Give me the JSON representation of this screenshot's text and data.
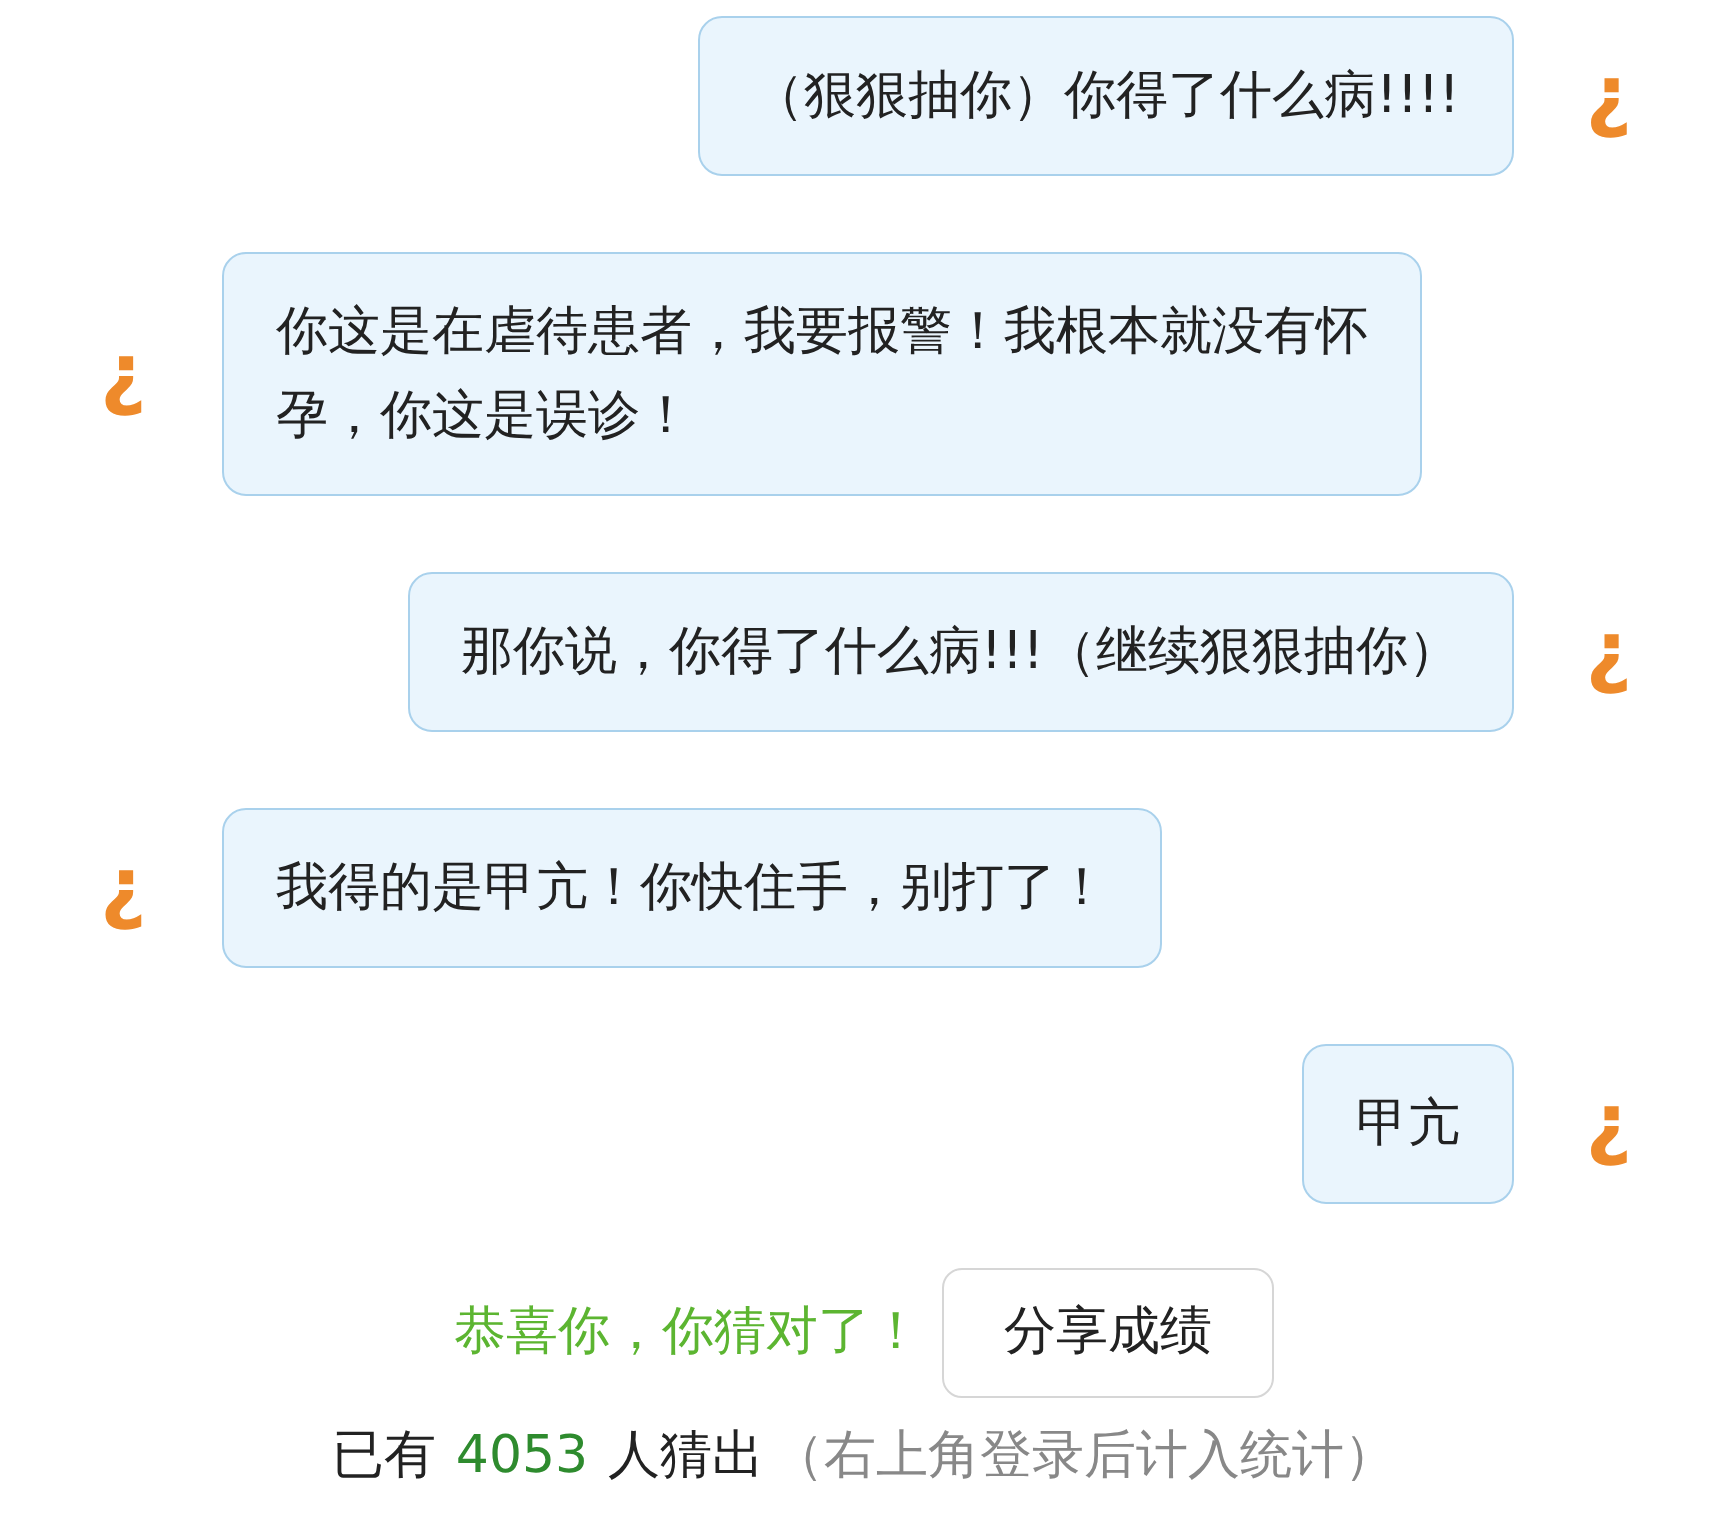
{
  "messages": [
    {
      "kind": "sent",
      "avatar": "¿",
      "text": "（狠狠抽你）你得了什么病!!!!"
    },
    {
      "kind": "received",
      "avatar": "¿",
      "text": "你这是在虐待患者，我要报警！我根本就没有怀孕，你这是误诊！"
    },
    {
      "kind": "sent",
      "avatar": "¿",
      "text": "那你说，你得了什么病!!!（继续狠狠抽你）"
    },
    {
      "kind": "received",
      "avatar": "¿",
      "text": "我得的是甲亢！你快住手，别打了！"
    },
    {
      "kind": "sent",
      "avatar": "¿",
      "text": "甲亢"
    }
  ],
  "result": {
    "message": "恭喜你，你猜对了！",
    "share_button": "分享成绩"
  },
  "stats": {
    "prefix": "已有",
    "count": "4053",
    "suffix": "人猜出",
    "note": "（右上角登录后计入统计）"
  }
}
